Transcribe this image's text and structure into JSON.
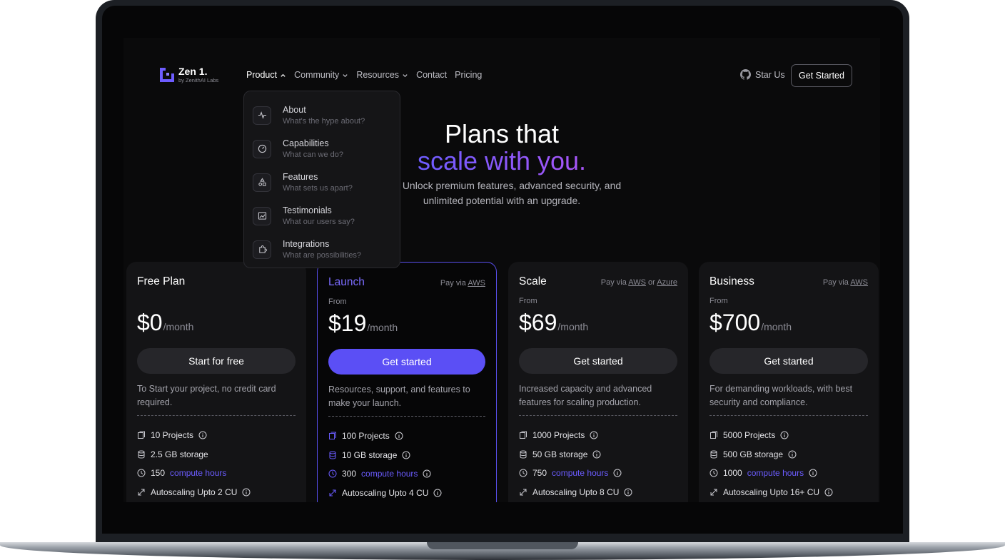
{
  "brand": {
    "name": "Zen 1.",
    "tagline": "by ZenithAI Labs",
    "accent": "#5b4ff5"
  },
  "nav": {
    "items": [
      {
        "label": "Product",
        "active": true,
        "chevron": "up"
      },
      {
        "label": "Community",
        "chevron": "down"
      },
      {
        "label": "Resources",
        "chevron": "down"
      },
      {
        "label": "Contact"
      },
      {
        "label": "Pricing"
      }
    ],
    "star_label": "Star Us",
    "cta_label": "Get Started"
  },
  "dropdown": {
    "items": [
      {
        "title": "About",
        "subtitle": "What's the hype about?",
        "icon": "activity-icon"
      },
      {
        "title": "Capabilities",
        "subtitle": "What can we do?",
        "icon": "gauge-icon"
      },
      {
        "title": "Features",
        "subtitle": "What sets us apart?",
        "icon": "shapes-icon"
      },
      {
        "title": "Testimonials",
        "subtitle": "What our users say?",
        "icon": "image-icon"
      },
      {
        "title": "Integrations",
        "subtitle": "What are possibilities?",
        "icon": "puzzle-icon"
      }
    ]
  },
  "hero": {
    "line1": "Plans that",
    "line2": "scale with you.",
    "desc_line1": "ree. Unlock premium features, advanced security, and",
    "desc_line2": "unlimited potential with an upgrade."
  },
  "plans": [
    {
      "name": "Free Plan",
      "pay_prefix": "",
      "pay": [],
      "from": "",
      "price": "$0",
      "per": "/month",
      "cta": "Start for free",
      "desc": "To Start your project, no credit card required.",
      "features": {
        "projects": "10 Projects",
        "storage": "2.5 GB storage",
        "hours_num": "150",
        "hours_label": "compute hours",
        "autoscale": "Autoscaling Upto 2 CU"
      }
    },
    {
      "name": "Launch",
      "pay_prefix": "Pay via",
      "pay": [
        "AWS"
      ],
      "from": "From",
      "price": "$19",
      "per": "/month",
      "cta": "Get started",
      "desc": "Resources, support, and features to make your launch.",
      "features": {
        "projects": "100 Projects",
        "storage": "10 GB storage",
        "hours_num": "300",
        "hours_label": "compute hours",
        "autoscale": "Autoscaling Upto 4 CU"
      }
    },
    {
      "name": "Scale",
      "pay_prefix": "Pay via",
      "pay": [
        "AWS",
        "Azure"
      ],
      "pay_sep": "or",
      "from": "From",
      "price": "$69",
      "per": "/month",
      "cta": "Get started",
      "desc": "Increased capacity and advanced features for scaling production.",
      "features": {
        "projects": "1000 Projects",
        "storage": "50 GB storage",
        "hours_num": "750",
        "hours_label": "compute hours",
        "autoscale": "Autoscaling Upto 8 CU"
      }
    },
    {
      "name": "Business",
      "pay_prefix": "Pay via",
      "pay": [
        "AWS"
      ],
      "from": "From",
      "price": "$700",
      "per": "/month",
      "cta": "Get started",
      "desc": "For demanding workloads, with best security and compliance.",
      "features": {
        "projects": "5000 Projects",
        "storage": "500 GB storage",
        "hours_num": "1000",
        "hours_label": "compute hours",
        "autoscale": "Autoscaling Upto 16+ CU"
      }
    }
  ]
}
